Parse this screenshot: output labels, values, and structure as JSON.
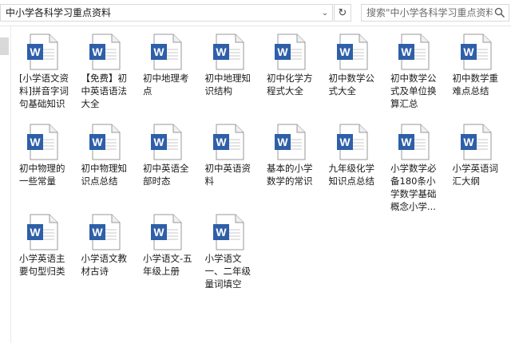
{
  "address_bar": {
    "path": "中小学各科学习重点资料"
  },
  "search": {
    "placeholder": "搜索\"中小学各科学习重点资料\""
  },
  "icons": {
    "file_type": "word-document-icon",
    "file_badge_letter": "W",
    "accent": "#2e5fa8"
  },
  "files": [
    {
      "name": "[小学语文资料]拼音字词句基础知识"
    },
    {
      "name": "【免费】初中英语语法大全"
    },
    {
      "name": "初中地理考点"
    },
    {
      "name": "初中地理知识结构"
    },
    {
      "name": "初中化学方程式大全"
    },
    {
      "name": "初中数学公式大全"
    },
    {
      "name": "初中数学公式及单位换算汇总"
    },
    {
      "name": "初中数学重难点总结"
    },
    {
      "name": "初中物理的一些常量"
    },
    {
      "name": "初中物理知识点总结"
    },
    {
      "name": "初中英语全部时态"
    },
    {
      "name": "初中英语资料"
    },
    {
      "name": "基本的小学数学的常识"
    },
    {
      "name": "九年级化学知识点总结"
    },
    {
      "name": "小学数学必备180条小学数学基础概念小学..."
    },
    {
      "name": "小学英语词汇大纲"
    },
    {
      "name": "小学英语主要句型归类"
    },
    {
      "name": "小学语文教材古诗"
    },
    {
      "name": "小学语文-五年级上册"
    },
    {
      "name": "小学语文一、二年级量词填空"
    }
  ]
}
